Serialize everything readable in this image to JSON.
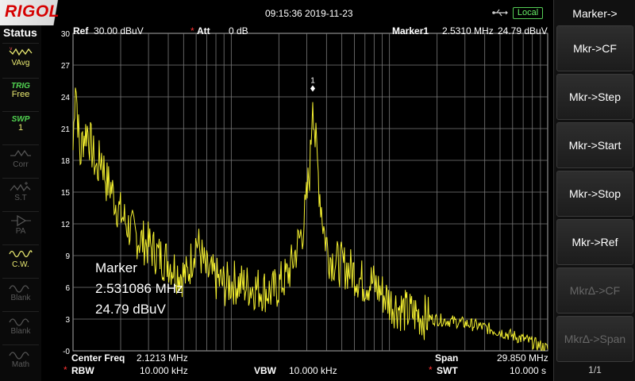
{
  "header": {
    "brand": "RIGOL",
    "datetime": "09:15:36 2019-11-23",
    "local_label": "Local",
    "usb_icon": "usb-icon"
  },
  "status": {
    "title": "Status",
    "items": [
      {
        "name": "vavg",
        "label": "VAvg",
        "icon": "avg-trace-icon",
        "active": true
      },
      {
        "name": "trig",
        "top": "TRIG",
        "label": "Free",
        "active": true
      },
      {
        "name": "swp",
        "top": "SWP",
        "label": "1",
        "active": true
      },
      {
        "name": "corr",
        "label": "Corr",
        "icon": "corr-icon",
        "active": false
      },
      {
        "name": "st",
        "label": "S.T",
        "icon": "st-icon",
        "active": false
      },
      {
        "name": "pa",
        "label": "PA",
        "icon": "pa-icon",
        "active": false
      },
      {
        "name": "cw",
        "label": "C.W.",
        "icon": "cw-icon",
        "active": true
      },
      {
        "name": "blank1",
        "label": "Blank",
        "icon": "blank-icon",
        "active": false
      },
      {
        "name": "blank2",
        "label": "Blank",
        "icon": "blank-icon",
        "active": false
      },
      {
        "name": "math",
        "label": "Math",
        "icon": "math-icon",
        "active": false
      }
    ]
  },
  "display": {
    "ref_label": "Ref",
    "ref_value": "30.00 dBuV",
    "att_label": "Att",
    "att_value": "0 dB",
    "marker_label": "Marker1",
    "marker_freq": "2.5310 MHz",
    "marker_level": "24.79 dBuV",
    "marker_number": "1",
    "readout_title": "Marker",
    "readout_freq": "2.531086 MHz",
    "readout_level": "24.79 dBuV"
  },
  "bottom": {
    "center_label": "Center Freq",
    "center_value": "2.1213 MHz",
    "span_label": "Span",
    "span_value": "29.850 MHz",
    "rbw_label": "RBW",
    "rbw_value": "10.000 kHz",
    "vbw_label": "VBW",
    "vbw_value": "10.000 kHz",
    "swt_label": "SWT",
    "swt_value": "10.000 s"
  },
  "menu": {
    "title": "Marker->",
    "items": [
      {
        "label": "Mkr->CF",
        "enabled": true
      },
      {
        "label": "Mkr->Step",
        "enabled": true
      },
      {
        "label": "Mkr->Start",
        "enabled": true
      },
      {
        "label": "Mkr->Stop",
        "enabled": true
      },
      {
        "label": "Mkr->Ref",
        "enabled": true
      },
      {
        "label": "Mkr∆->CF",
        "enabled": false
      },
      {
        "label": "Mkr∆->Span",
        "enabled": false
      }
    ],
    "page": "1/1"
  },
  "chart_data": {
    "type": "line",
    "xscale": "log",
    "ylabel_ticks": [
      "30",
      "27",
      "24",
      "21",
      "18",
      "15",
      "12",
      "9",
      "6",
      "3",
      "-0"
    ],
    "ylim": [
      0,
      30
    ],
    "trace_color": "#f4f030",
    "grid": true,
    "marker": {
      "x_fraction": 0.505,
      "y": 24.79
    },
    "series": [
      {
        "x": [
          0.0,
          0.005,
          0.01,
          0.015,
          0.02,
          0.03,
          0.04,
          0.05,
          0.06,
          0.07,
          0.08,
          0.09,
          0.1,
          0.12,
          0.14,
          0.16,
          0.18,
          0.2,
          0.22,
          0.24,
          0.26,
          0.28,
          0.3,
          0.32,
          0.34,
          0.35,
          0.36,
          0.38,
          0.4,
          0.42,
          0.44,
          0.45,
          0.46,
          0.47,
          0.48,
          0.49,
          0.5,
          0.505,
          0.51,
          0.52,
          0.53,
          0.54,
          0.55,
          0.57,
          0.59,
          0.61,
          0.63,
          0.65,
          0.67,
          0.69,
          0.7,
          0.72,
          0.74,
          0.76,
          0.8,
          0.85,
          0.9,
          0.95,
          1.0
        ],
        "y": [
          19,
          26,
          22,
          18,
          20,
          21,
          19,
          17,
          18.5,
          16,
          15.5,
          14,
          13,
          11.5,
          10.5,
          10,
          9,
          8.5,
          7.5,
          7,
          10.5,
          7.5,
          6.8,
          6.2,
          6.5,
          6.3,
          6.2,
          6.0,
          5.8,
          5.5,
          6.5,
          7,
          8,
          9.5,
          11,
          13,
          18,
          24.79,
          20,
          15,
          11,
          9,
          8.5,
          8,
          7.5,
          6.5,
          6.5,
          5.5,
          4.5,
          4,
          3.7,
          3.5,
          3.2,
          3,
          2.8,
          2.4,
          1.8,
          1.1,
          0.2
        ]
      }
    ]
  }
}
